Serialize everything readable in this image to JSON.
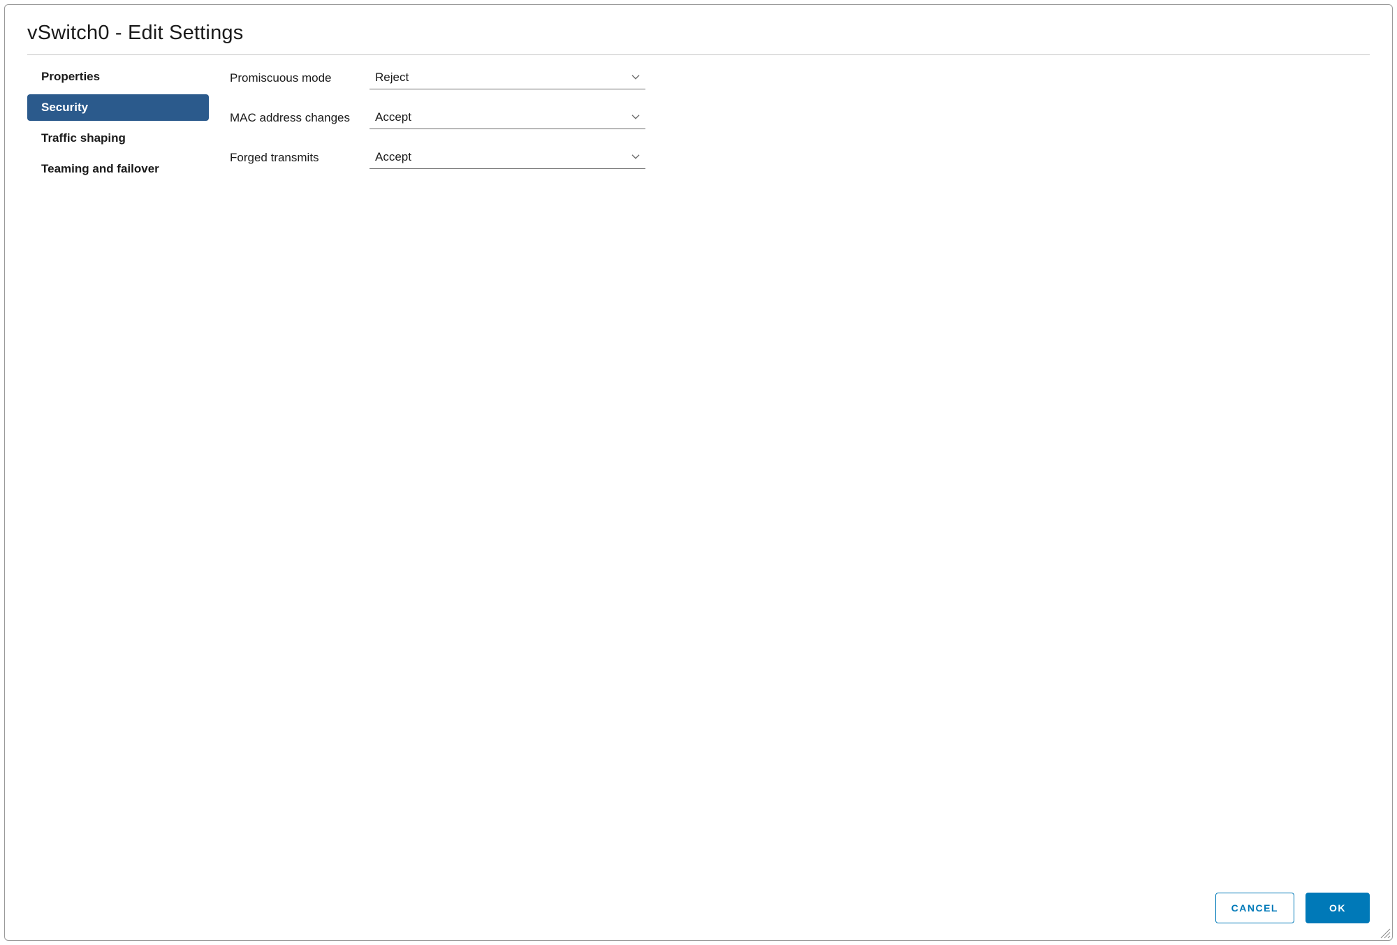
{
  "dialog": {
    "title": "vSwitch0 - Edit Settings"
  },
  "sidebar": {
    "items": [
      {
        "label": "Properties",
        "active": false
      },
      {
        "label": "Security",
        "active": true
      },
      {
        "label": "Traffic shaping",
        "active": false
      },
      {
        "label": "Teaming and failover",
        "active": false
      }
    ]
  },
  "form": {
    "rows": [
      {
        "label": "Promiscuous mode",
        "value": "Reject"
      },
      {
        "label": "MAC address changes",
        "value": "Accept"
      },
      {
        "label": "Forged transmits",
        "value": "Accept"
      }
    ]
  },
  "footer": {
    "cancel_label": "CANCEL",
    "ok_label": "OK"
  }
}
